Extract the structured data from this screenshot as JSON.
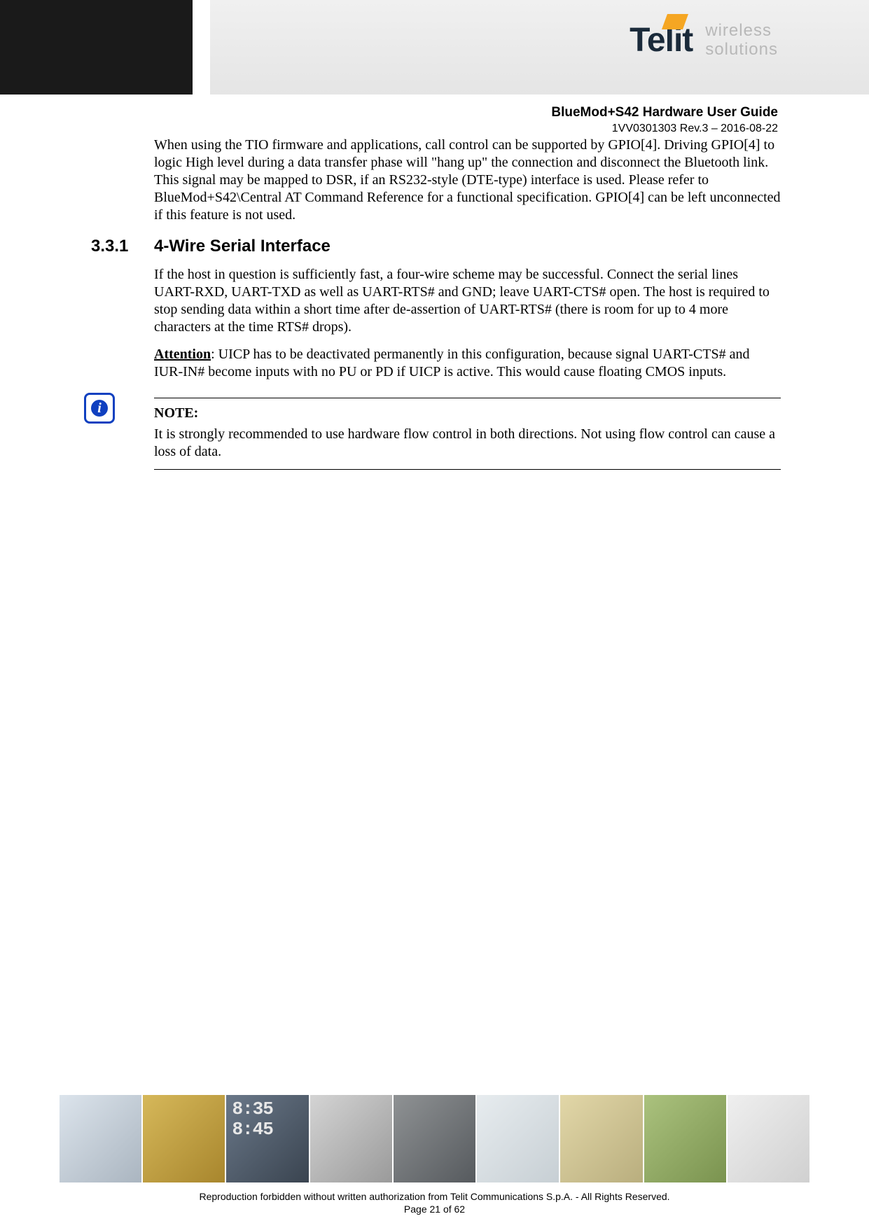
{
  "logo": {
    "brand": "Telit",
    "tagline_line1": "wireless",
    "tagline_line2": "solutions"
  },
  "header": {
    "doc_title": "BlueMod+S42 Hardware User Guide",
    "doc_rev": "1VV0301303 Rev.3 – 2016-08-22"
  },
  "body": {
    "para1": "When using the TIO firmware and applications, call control can be supported by GPIO[4]. Driving GPIO[4] to logic High level during a data transfer phase will \"hang up\" the connection and disconnect the Bluetooth link. This signal may be mapped to DSR, if an RS232-style (DTE-type) interface is used. Please refer to BlueMod+S42\\Central AT Command Reference for a functional specification. GPIO[4] can be left unconnected if this feature is not used.",
    "section_num": "3.3.1",
    "section_title": "4-Wire Serial Interface",
    "para2": "If the host in question is sufficiently fast, a four-wire scheme may be successful. Connect the serial lines UART-RXD, UART-TXD as well as UART-RTS# and GND; leave UART-CTS# open. The host is required to stop sending data within a short time after de-assertion of UART-RTS# (there is room for up to 4 more characters at the time RTS# drops).",
    "attention_label": "Attention",
    "para3_rest": ": UICP has to be deactivated permanently in this configuration, because signal UART-CTS# and IUR-IN# become inputs with no PU or PD if UICP is active. This would cause floating CMOS inputs.",
    "note_label": "NOTE:",
    "note_text": "It is strongly recommended to use hardware flow control in both directions. Not using flow control can cause a loss of data."
  },
  "footer": {
    "times": "8:35\n8:45",
    "copyright": "Reproduction forbidden without written authorization from Telit Communications S.p.A. - All Rights Reserved.",
    "page_label": "Page 21 of 62"
  }
}
